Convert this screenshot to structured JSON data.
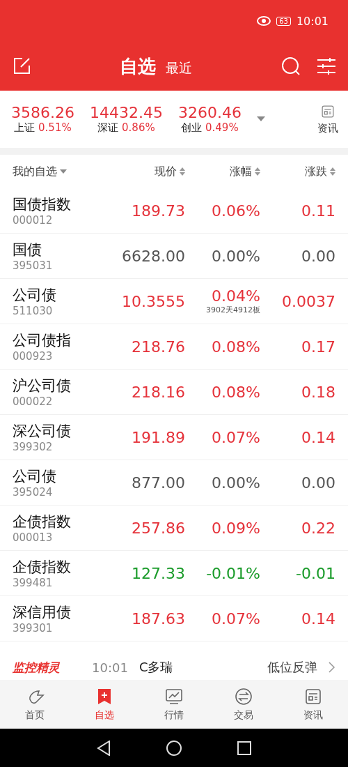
{
  "status_bar": {
    "time": "10:01",
    "battery": "63"
  },
  "header": {
    "tabs": [
      {
        "label": "自选",
        "selected": true
      },
      {
        "label": "最近",
        "selected": false
      }
    ]
  },
  "indices": [
    {
      "value": "3586.26",
      "name": "上证",
      "change": "0.51%"
    },
    {
      "value": "14432.45",
      "name": "深证",
      "change": "0.86%"
    },
    {
      "value": "3260.46",
      "name": "创业",
      "change": "0.49%"
    }
  ],
  "news_button": "资讯",
  "columns": [
    "我的自选",
    "现价",
    "涨幅",
    "涨跌"
  ],
  "rows": [
    {
      "name": "国债指数",
      "code": "000012",
      "price": "189.73",
      "pct": "0.06%",
      "change": "0.11",
      "color": "#e5323a"
    },
    {
      "name": "国债",
      "code": "395031",
      "price": "6628.00",
      "pct": "0.00%",
      "change": "0.00",
      "color": "#555555"
    },
    {
      "name": "公司债",
      "code": "511030",
      "price": "10.3555",
      "pct": "0.04%",
      "note": "3902天4912板",
      "change": "0.0037",
      "color": "#e5323a"
    },
    {
      "name": "公司债指",
      "code": "000923",
      "price": "218.76",
      "pct": "0.08%",
      "change": "0.17",
      "color": "#e5323a"
    },
    {
      "name": "沪公司债",
      "code": "000022",
      "price": "218.16",
      "pct": "0.08%",
      "change": "0.18",
      "color": "#e5323a"
    },
    {
      "name": "深公司债",
      "code": "399302",
      "price": "191.89",
      "pct": "0.07%",
      "change": "0.14",
      "color": "#e5323a"
    },
    {
      "name": "公司债",
      "code": "395024",
      "price": "877.00",
      "pct": "0.00%",
      "change": "0.00",
      "color": "#555555"
    },
    {
      "name": "企债指数",
      "code": "000013",
      "price": "257.86",
      "pct": "0.09%",
      "change": "0.22",
      "color": "#e5323a"
    },
    {
      "name": "企债指数",
      "code": "399481",
      "price": "127.33",
      "pct": "-0.01%",
      "change": "-0.01",
      "color": "#1a9b2a"
    },
    {
      "name": "深信用债",
      "code": "399301",
      "price": "187.63",
      "pct": "0.07%",
      "change": "0.14",
      "color": "#e5323a"
    }
  ],
  "monitor": {
    "title": "监控精灵",
    "time": "10:01",
    "stock": "C多瑞",
    "signal": "低位反弹"
  },
  "tab_bar": [
    {
      "label": "首页",
      "selected": false
    },
    {
      "label": "自选",
      "selected": true
    },
    {
      "label": "行情",
      "selected": false
    },
    {
      "label": "交易",
      "selected": false
    },
    {
      "label": "资讯",
      "selected": false
    }
  ]
}
